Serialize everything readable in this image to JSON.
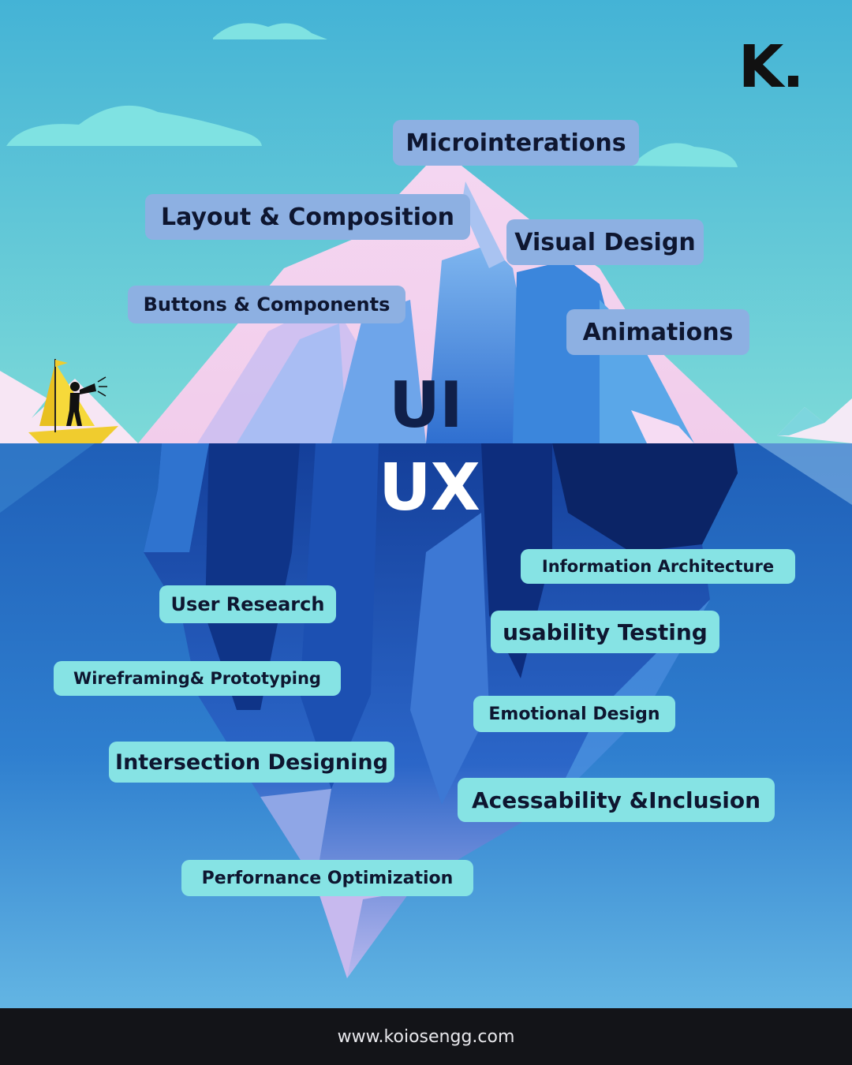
{
  "brand": {
    "logo_text": "K."
  },
  "layers": {
    "ui": "UI",
    "ux": "UX"
  },
  "ui_topics": [
    "Microinterations",
    "Layout & Composition",
    "Visual Design",
    "Buttons & Components",
    "Animations"
  ],
  "ux_topics": [
    "Information Architecture",
    "User Research",
    "usability Testing",
    "Wireframing& Prototyping",
    "Emotional Design",
    "Intersection Designing",
    "Acessability &Inclusion",
    "Perfornance Optimization"
  ],
  "footer": {
    "url": "www.koiosengg.com"
  },
  "colors": {
    "sky_top": "#44b3d6",
    "sky_bottom": "#7ddad8",
    "water_top": "#1f5fb8",
    "water_bottom": "#5aaee0",
    "ui_tag": "#8db0e2",
    "ux_tag": "#86e3e4",
    "footer_bg": "#131418"
  },
  "icons": [
    "sailboat-icon",
    "megaphone-person-icon",
    "cloud-icon",
    "iceberg-illustration"
  ]
}
